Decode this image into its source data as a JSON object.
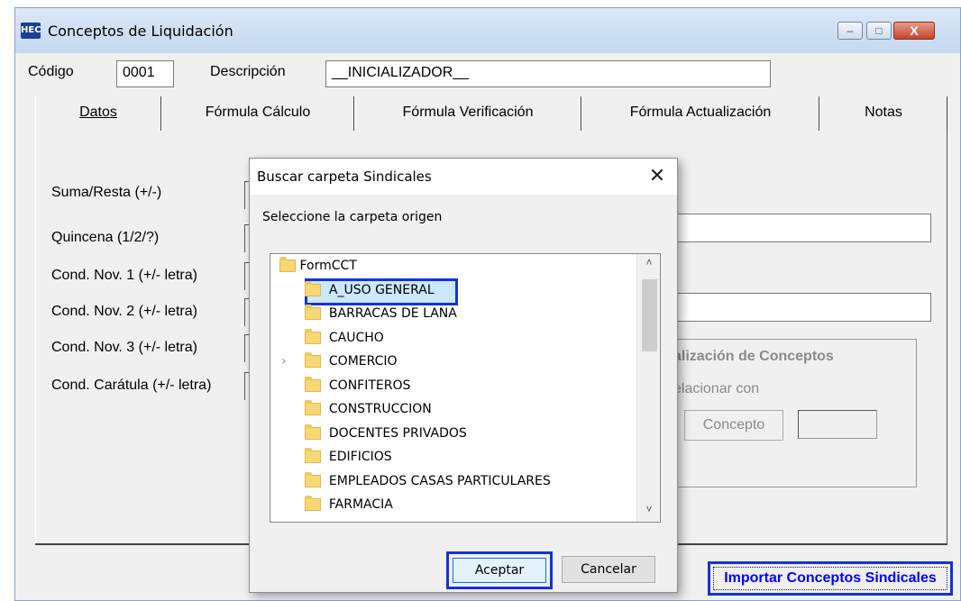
{
  "window": {
    "title": "Conceptos de Liquidación",
    "app_icon_text": "HEC",
    "controls": {
      "minimize": "–",
      "maximize": "□",
      "close": "X"
    }
  },
  "header": {
    "codigo_label": "Código",
    "codigo_value": "0001",
    "descripcion_label": "Descripción",
    "descripcion_value": "__INICIALIZADOR__"
  },
  "tabs": [
    {
      "label": "Datos",
      "active": true
    },
    {
      "label": "Fórmula Cálculo"
    },
    {
      "label": "Fórmula Verificación"
    },
    {
      "label": "Fórmula Actualización"
    },
    {
      "label": "Notas"
    }
  ],
  "datos": {
    "rows": [
      "Suma/Resta (+/-)",
      "Quincena (1/2/?)",
      "Cond. Nov. 1 (+/- letra)",
      "Cond. Nov. 2 (+/- letra)",
      "Cond. Nov. 3 (+/- letra)",
      "Cond. Carátula (+/- letra)"
    ],
    "group_title": "alización de Conceptos",
    "group_sub": "elacionar con",
    "concepto_button": "Concepto"
  },
  "import_button": "Importar Conceptos Sindicales",
  "dialog": {
    "title": "Buscar carpeta Sindicales",
    "close": "✕",
    "prompt": "Seleccione la carpeta origen",
    "root": "FormCCT",
    "folders": [
      "A_USO GENERAL",
      "BARRACAS DE LANA",
      "CAUCHO",
      "COMERCIO",
      "CONFITEROS",
      "CONSTRUCCION",
      "DOCENTES PRIVADOS",
      "EDIFICIOS",
      "EMPLEADOS CASAS PARTICULARES",
      "FARMACIA"
    ],
    "selected": "A_USO GENERAL",
    "ok_button": "Aceptar",
    "cancel_button": "Cancelar"
  },
  "colors": {
    "highlight_border": "#1432d8",
    "import_text": "#0000ff"
  }
}
